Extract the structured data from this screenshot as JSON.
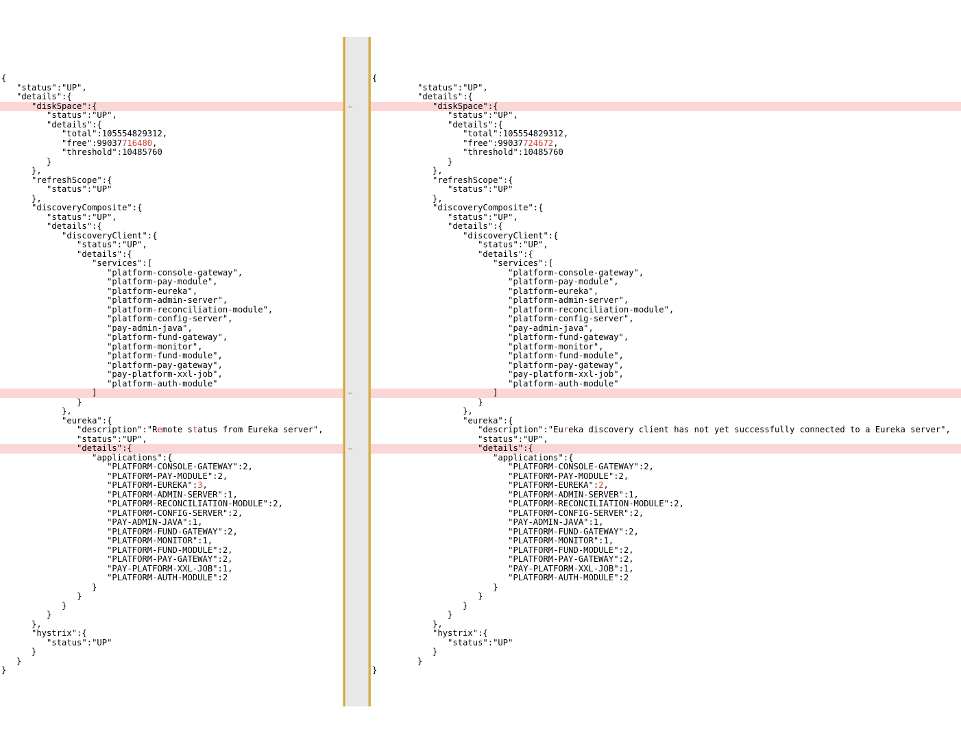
{
  "left": {
    "lines": [
      "{",
      "   \"status\":\"UP\",",
      "   \"details\":{",
      "      \"diskSpace\":{",
      "         \"status\":\"UP\",",
      "         \"details\":{",
      "            \"total\":105554829312,",
      "            \"free\":99037716480,",
      "            \"threshold\":10485760",
      "         }",
      "      },",
      "      \"refreshScope\":{",
      "         \"status\":\"UP\"",
      "      },",
      "      \"discoveryComposite\":{",
      "         \"status\":\"UP\",",
      "         \"details\":{",
      "            \"discoveryClient\":{",
      "               \"status\":\"UP\",",
      "               \"details\":{",
      "                  \"services\":[",
      "                     \"platform-console-gateway\",",
      "                     \"platform-pay-module\",",
      "                     \"platform-eureka\",",
      "                     \"platform-admin-server\",",
      "                     \"platform-reconciliation-module\",",
      "                     \"platform-config-server\",",
      "                     \"pay-admin-java\",",
      "                     \"platform-fund-gateway\",",
      "                     \"platform-monitor\",",
      "                     \"platform-fund-module\",",
      "                     \"platform-pay-gateway\",",
      "                     \"pay-platform-xxl-job\",",
      "                     \"platform-auth-module\"",
      "                  ]",
      "               }",
      "            },",
      "            \"eureka\":{",
      "               \"description\":\"Remote status from Eureka server\",",
      "               \"status\":\"UP\",",
      "               \"details\":{",
      "                  \"applications\":{",
      "                     \"PLATFORM-CONSOLE-GATEWAY\":2,",
      "                     \"PLATFORM-PAY-MODULE\":2,",
      "                     \"PLATFORM-EUREKA\":3,",
      "                     \"PLATFORM-ADMIN-SERVER\":1,",
      "                     \"PLATFORM-RECONCILIATION-MODULE\":2,",
      "                     \"PLATFORM-CONFIG-SERVER\":2,",
      "                     \"PAY-ADMIN-JAVA\":1,",
      "                     \"PLATFORM-FUND-GATEWAY\":2,",
      "                     \"PLATFORM-MONITOR\":1,",
      "                     \"PLATFORM-FUND-MODULE\":2,",
      "                     \"PLATFORM-PAY-GATEWAY\":2,",
      "                     \"PAY-PLATFORM-XXL-JOB\":1,",
      "                     \"PLATFORM-AUTH-MODULE\":2",
      "                  }",
      "               }",
      "            }",
      "         }",
      "      },",
      "      \"hystrix\":{",
      "         \"status\":\"UP\"",
      "      }",
      "   }",
      "}"
    ],
    "diff_lines": [
      7,
      38,
      44
    ],
    "diffs": {
      "7": {
        "pre": "            \"free\":99037",
        "mid": "716480",
        "post": ","
      },
      "38": {
        "pre": "               \"description\":\"R",
        "mid": "e",
        "post1": "mote s",
        "mid2": "t",
        "post2": "atus",
        "mid3": "",
        "post3": " from",
        "mid4": "",
        "post4": " Eureka server\","
      },
      "44": {
        "pre": "                     \"PLATFORM-EUREKA\":",
        "mid": "3",
        "post": ","
      }
    }
  },
  "right": {
    "indent": "      ",
    "lines": [
      "{",
      "   \"status\":\"UP\",",
      "   \"details\":{",
      "      \"diskSpace\":{",
      "         \"status\":\"UP\",",
      "         \"details\":{",
      "            \"total\":105554829312,",
      "            \"free\":99037724672,",
      "            \"threshold\":10485760",
      "         }",
      "      },",
      "      \"refreshScope\":{",
      "         \"status\":\"UP\"",
      "      },",
      "      \"discoveryComposite\":{",
      "         \"status\":\"UP\",",
      "         \"details\":{",
      "            \"discoveryClient\":{",
      "               \"status\":\"UP\",",
      "               \"details\":{",
      "                  \"services\":[",
      "                     \"platform-console-gateway\",",
      "                     \"platform-pay-module\",",
      "                     \"platform-eureka\",",
      "                     \"platform-admin-server\",",
      "                     \"platform-reconciliation-module\",",
      "                     \"platform-config-server\",",
      "                     \"pay-admin-java\",",
      "                     \"platform-fund-gateway\",",
      "                     \"platform-monitor\",",
      "                     \"platform-fund-module\",",
      "                     \"platform-pay-gateway\",",
      "                     \"pay-platform-xxl-job\",",
      "                     \"platform-auth-module\"",
      "                  ]",
      "               }",
      "            },",
      "            \"eureka\":{",
      "               \"description\":\"Eureka discovery client has not yet successfully connected to a Eureka server\",",
      "               \"status\":\"UP\",",
      "               \"details\":{",
      "                  \"applications\":{",
      "                     \"PLATFORM-CONSOLE-GATEWAY\":2,",
      "                     \"PLATFORM-PAY-MODULE\":2,",
      "                     \"PLATFORM-EUREKA\":2,",
      "                     \"PLATFORM-ADMIN-SERVER\":1,",
      "                     \"PLATFORM-RECONCILIATION-MODULE\":2,",
      "                     \"PLATFORM-CONFIG-SERVER\":2,",
      "                     \"PAY-ADMIN-JAVA\":1,",
      "                     \"PLATFORM-FUND-GATEWAY\":2,",
      "                     \"PLATFORM-MONITOR\":1,",
      "                     \"PLATFORM-FUND-MODULE\":2,",
      "                     \"PLATFORM-PAY-GATEWAY\":2,",
      "                     \"PAY-PLATFORM-XXL-JOB\":1,",
      "                     \"PLATFORM-AUTH-MODULE\":2",
      "                  }",
      "               }",
      "            }",
      "         }",
      "      },",
      "      \"hystrix\":{",
      "         \"status\":\"UP\"",
      "      }",
      "   }",
      "}"
    ],
    "diff_lines": [
      7,
      38,
      44
    ],
    "diffs": {
      "7": {
        "pre": "            \"free\":99037",
        "mid": "724672",
        "post": ","
      },
      "38": {
        "pre": "               \"description\":\"Eu",
        "mid": "r",
        "post": "eka discovery client has not yet successfully connected to a Eureka server\","
      },
      "44": {
        "pre": "                     \"PLATFORM-EUREKA\":",
        "mid": "2",
        "post": ","
      }
    }
  },
  "gutter": {
    "arrows": [
      7,
      38,
      44
    ],
    "arrow_glyph": "⇦"
  }
}
